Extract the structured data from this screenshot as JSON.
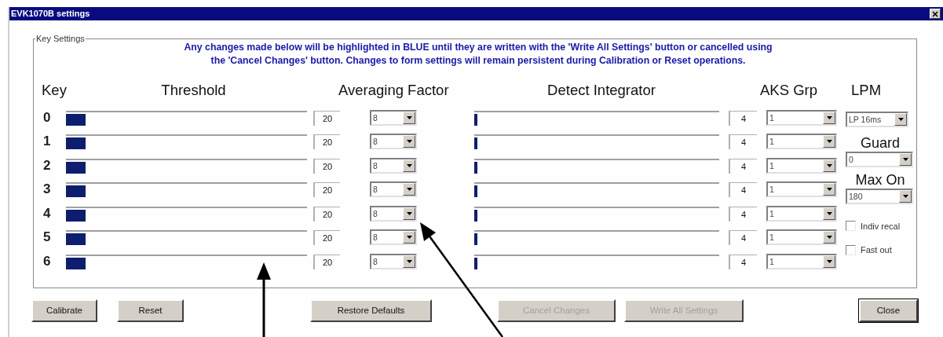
{
  "window": {
    "title": "EVK1070B settings"
  },
  "group": {
    "legend": "Key Settings",
    "notice": [
      "Any changes made below will be highlighted in BLUE until they are written with the 'Write All Settings' button or cancelled using",
      "the 'Cancel Changes' button. Changes to form settings will remain persistent during Calibration or Reset operations."
    ]
  },
  "columns": [
    "Key",
    "Threshold",
    "Averaging Factor",
    "Detect Integrator",
    "AKS Grp"
  ],
  "keys": [
    {
      "key": "0",
      "threshold": {
        "level": 0.08,
        "value": "20"
      },
      "averaging": "8",
      "detect": {
        "level": 0.012,
        "value": "4"
      },
      "aks_grp": "1"
    },
    {
      "key": "1",
      "threshold": {
        "level": 0.08,
        "value": "20"
      },
      "averaging": "8",
      "detect": {
        "level": 0.012,
        "value": "4"
      },
      "aks_grp": "1"
    },
    {
      "key": "2",
      "threshold": {
        "level": 0.08,
        "value": "20"
      },
      "averaging": "8",
      "detect": {
        "level": 0.012,
        "value": "4"
      },
      "aks_grp": "1"
    },
    {
      "key": "3",
      "threshold": {
        "level": 0.08,
        "value": "20"
      },
      "averaging": "8",
      "detect": {
        "level": 0.012,
        "value": "4"
      },
      "aks_grp": "1"
    },
    {
      "key": "4",
      "threshold": {
        "level": 0.08,
        "value": "20"
      },
      "averaging": "8",
      "detect": {
        "level": 0.012,
        "value": "4"
      },
      "aks_grp": "1"
    },
    {
      "key": "5",
      "threshold": {
        "level": 0.08,
        "value": "20"
      },
      "averaging": "8",
      "detect": {
        "level": 0.012,
        "value": "4"
      },
      "aks_grp": "1"
    },
    {
      "key": "6",
      "threshold": {
        "level": 0.08,
        "value": "20"
      },
      "averaging": "8",
      "detect": {
        "level": 0.012,
        "value": "4"
      },
      "aks_grp": "1"
    }
  ],
  "lpm": {
    "label": "LPM",
    "value": "LP 16ms"
  },
  "guard": {
    "label": "Guard",
    "value": "0"
  },
  "max_on": {
    "label": "Max On",
    "value": "180"
  },
  "options": [
    {
      "label": "Indiv recal",
      "checked": false
    },
    {
      "label": "Fast out",
      "checked": false
    }
  ],
  "buttons": [
    {
      "label": "Calibrate",
      "disabled": false,
      "default": false
    },
    {
      "label": "Reset",
      "disabled": false,
      "default": false
    },
    {
      "label": "Restore Defaults",
      "disabled": false,
      "default": false
    },
    {
      "label": "Cancel Changes",
      "disabled": true,
      "default": false
    },
    {
      "label": "Write All Settings",
      "disabled": true,
      "default": false
    },
    {
      "label": "Close",
      "disabled": false,
      "default": true
    }
  ]
}
